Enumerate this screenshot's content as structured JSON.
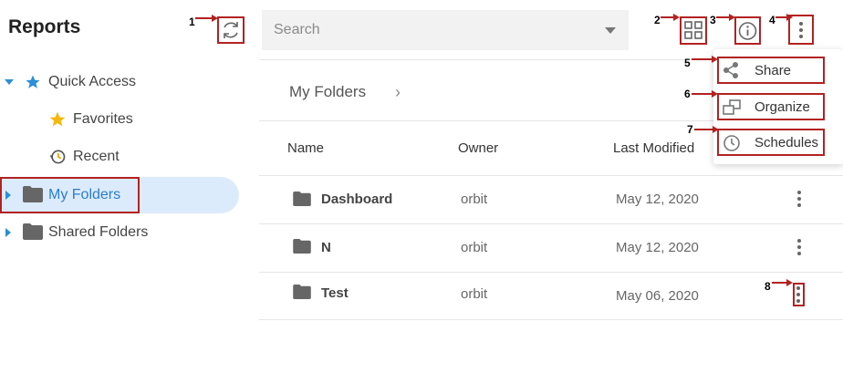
{
  "app": {
    "title": "Reports"
  },
  "sidebar": {
    "items": [
      {
        "label": "Quick Access"
      },
      {
        "label": "Favorites"
      },
      {
        "label": "Recent"
      },
      {
        "label": "My Folders"
      },
      {
        "label": "Shared Folders"
      }
    ]
  },
  "search": {
    "placeholder": "Search"
  },
  "breadcrumb": {
    "label": "My Folders",
    "separator": "›"
  },
  "table": {
    "headers": {
      "name": "Name",
      "owner": "Owner",
      "modified": "Last Modified"
    },
    "rows": [
      {
        "name": "Dashboard",
        "owner": "orbit",
        "modified": "May 12, 2020"
      },
      {
        "name": "N",
        "owner": "orbit",
        "modified": "May 12, 2020"
      },
      {
        "name": "Test",
        "owner": "orbit",
        "modified": "May 06, 2020"
      }
    ]
  },
  "menu": {
    "items": [
      {
        "label": "Share",
        "icon": "share-icon"
      },
      {
        "label": "Organize",
        "icon": "organize-icon"
      },
      {
        "label": "Schedules",
        "icon": "clock-icon"
      }
    ]
  },
  "callouts": [
    "1",
    "2",
    "3",
    "4",
    "5",
    "6",
    "7",
    "8"
  ],
  "colors": {
    "accent": "#2a8fd6",
    "selected_bg": "#dcebfb",
    "callout_red": "#b22222",
    "star_gold": "#f5b80d"
  }
}
